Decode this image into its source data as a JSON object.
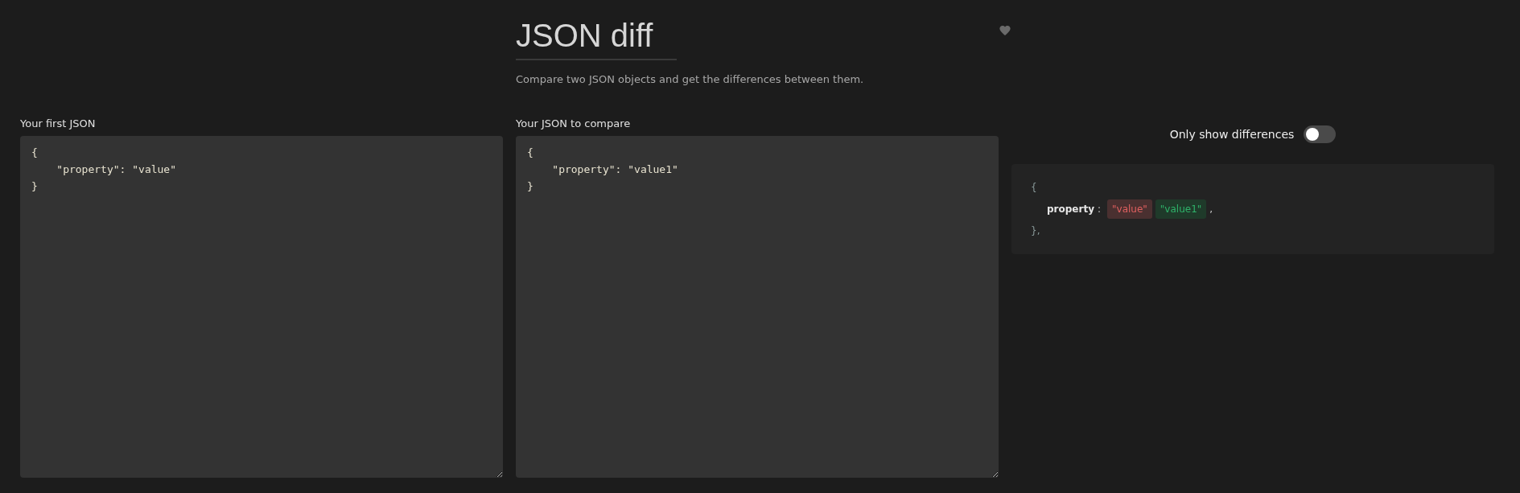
{
  "header": {
    "title": "JSON diff",
    "subtitle": "Compare two JSON objects and get the differences between them.",
    "favorite": false
  },
  "editors": [
    {
      "label": "Your first JSON",
      "value": "{\n    \"property\": \"value\"\n}"
    },
    {
      "label": "Your JSON to compare",
      "value": "{\n    \"property\": \"value1\"\n}"
    }
  ],
  "diff_toggle": {
    "label": "Only show differences",
    "on": false
  },
  "result": {
    "open": "{",
    "rows": [
      {
        "key": "property",
        "separator": ":",
        "removed": "\"value\"",
        "added": "\"value1\"",
        "trailing": ","
      }
    ],
    "close": "},"
  }
}
